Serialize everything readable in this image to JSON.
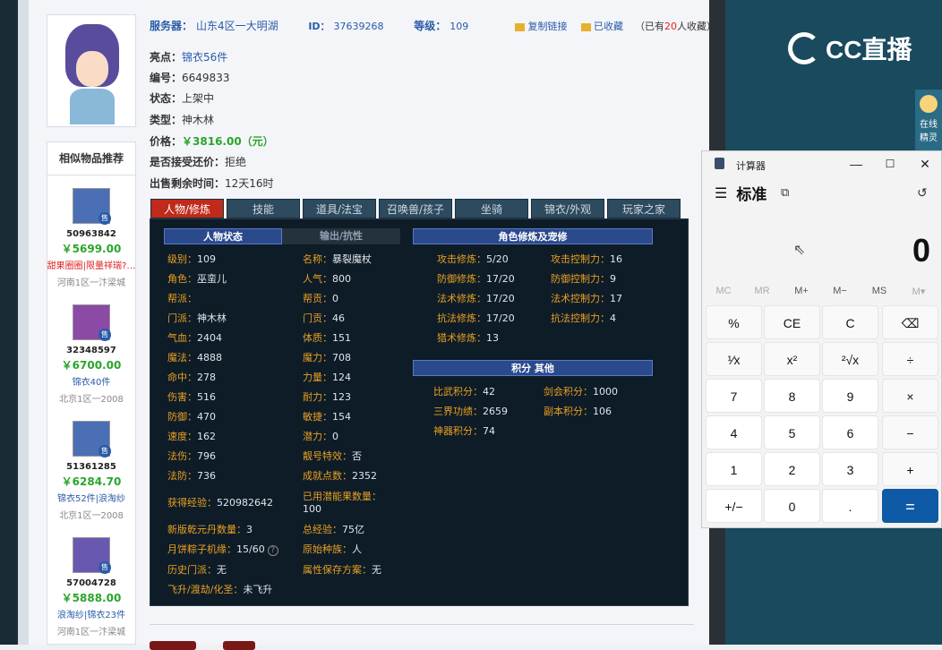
{
  "top": {
    "server_label": "服务器：",
    "server_value": "山东4区一大明湖",
    "id_label": "ID：",
    "id_value": "37639268",
    "level_label": "等级：",
    "level_value": "109",
    "copy_link": "复制链接",
    "favorited": "已收藏",
    "fav_count_prefix": "（已有",
    "fav_count": "20",
    "fav_count_suffix": "人收藏）"
  },
  "info": {
    "highlight_label": "亮点：",
    "highlight_value": "锦衣56件",
    "serial_label": "编号：",
    "serial_value": "6649833",
    "status_label": "状态：",
    "status_value": "上架中",
    "type_label": "类型：",
    "type_value": "神木林",
    "price_label": "价格：",
    "price_value": "￥3816.00（元）",
    "bargain_label": "是否接受还价：",
    "bargain_value": "拒绝",
    "remaining_label": "出售剩余时间：",
    "remaining_value": "12天16时"
  },
  "similar": {
    "title": "相似物品推荐",
    "sale_badge": "售",
    "items": [
      {
        "id": "50963842",
        "price": "￥5699.00",
        "desc": "甜果圈圈|限量祥瑞?…",
        "area": "河南1区一汴梁城"
      },
      {
        "id": "32348597",
        "price": "￥6700.00",
        "desc": "锦衣40件",
        "area": "北京1区一2008"
      },
      {
        "id": "51361285",
        "price": "￥6284.70",
        "desc": "锦衣52件|浪淘纱",
        "area": "北京1区一2008"
      },
      {
        "id": "57004728",
        "price": "￥5888.00",
        "desc": "浪淘纱|锦衣23件",
        "area": "河南1区一汴梁城"
      }
    ]
  },
  "tabs": [
    "人物/修炼",
    "技能",
    "道具/法宝",
    "召唤兽/孩子",
    "坐骑",
    "锦衣/外观",
    "玩家之家"
  ],
  "board": {
    "head_status": "人物状态",
    "head_output": "输出/抗性",
    "head_cultivation": "角色修炼及宠修",
    "head_points": "积分 其他",
    "col1": [
      {
        "k": "级别：",
        "v": "109"
      },
      {
        "k": "角色：",
        "v": "巫蛮儿"
      },
      {
        "k": "帮派：",
        "v": ""
      },
      {
        "k": "门派：",
        "v": "神木林"
      },
      {
        "k": "气血：",
        "v": "2404"
      },
      {
        "k": "魔法：",
        "v": "4888"
      },
      {
        "k": "命中：",
        "v": "278"
      },
      {
        "k": "伤害：",
        "v": "516"
      },
      {
        "k": "防御：",
        "v": "470"
      },
      {
        "k": "速度：",
        "v": "162"
      },
      {
        "k": "法伤：",
        "v": "796"
      },
      {
        "k": "法防：",
        "v": "736"
      }
    ],
    "col2": [
      {
        "k": "名称：",
        "v": "暴裂魔杖"
      },
      {
        "k": "人气：",
        "v": "800"
      },
      {
        "k": "帮贡：",
        "v": "0"
      },
      {
        "k": "门贡：",
        "v": "46"
      },
      {
        "k": "体质：",
        "v": "151"
      },
      {
        "k": "魔力：",
        "v": "708"
      },
      {
        "k": "力量：",
        "v": "124"
      },
      {
        "k": "耐力：",
        "v": "123"
      },
      {
        "k": "敏捷：",
        "v": "154"
      },
      {
        "k": "潜力：",
        "v": "0"
      },
      {
        "k": "靓号特效：",
        "v": "否"
      },
      {
        "k": "成就点数：",
        "v": "2352"
      }
    ],
    "exp_label": "获得经验：",
    "exp_value": "520982642",
    "used_potential_label": "已用潜能果数量：",
    "used_potential_value": "100",
    "qianyuan_label": "新版乾元丹数量：",
    "qianyuan_value": "3",
    "total_exp_label": "总经验：",
    "total_exp_value": "75亿",
    "mooncake_label": "月饼粽子机缘：",
    "mooncake_value": "15/60",
    "orig_race_label": "原始种族：",
    "orig_race_value": "人",
    "history_label": "历史门派：",
    "history_value": "无",
    "attr_save_label": "属性保存方案：",
    "attr_save_value": "无",
    "ascend_label": "飞升/渡劫/化圣：",
    "ascend_value": "未飞升",
    "cult_left": [
      {
        "k": "攻击修炼：",
        "v": "5/20"
      },
      {
        "k": "防御修炼：",
        "v": "17/20"
      },
      {
        "k": "法术修炼：",
        "v": "17/20"
      },
      {
        "k": "抗法修炼：",
        "v": "17/20"
      },
      {
        "k": "猎术修炼：",
        "v": "13"
      }
    ],
    "cult_right": [
      {
        "k": "攻击控制力：",
        "v": "16"
      },
      {
        "k": "防御控制力：",
        "v": "9"
      },
      {
        "k": "法术控制力：",
        "v": "17"
      },
      {
        "k": "抗法控制力：",
        "v": "4"
      }
    ],
    "points_left": [
      {
        "k": "比武积分：",
        "v": "42"
      },
      {
        "k": "三界功绩：",
        "v": "2659"
      },
      {
        "k": "神器积分：",
        "v": "74"
      }
    ],
    "points_right": [
      {
        "k": "剑会积分：",
        "v": "1000"
      },
      {
        "k": "副本积分：",
        "v": "106"
      }
    ]
  },
  "cc": {
    "logo_text": "CC直播",
    "kefu_line1": "在线",
    "kefu_line2": "精灵"
  },
  "calculator": {
    "window_title": "计算器",
    "mode": "标准",
    "display": "0",
    "memory": [
      "MC",
      "MR",
      "M+",
      "M−",
      "MS",
      "M▾"
    ],
    "keys": [
      [
        "%",
        "CE",
        "C",
        "⌫"
      ],
      [
        "¹⁄x",
        "x²",
        "²√x",
        "÷"
      ],
      [
        "7",
        "8",
        "9",
        "×"
      ],
      [
        "4",
        "5",
        "6",
        "−"
      ],
      [
        "1",
        "2",
        "3",
        "+"
      ],
      [
        "+/−",
        "0",
        ".",
        "="
      ]
    ]
  }
}
